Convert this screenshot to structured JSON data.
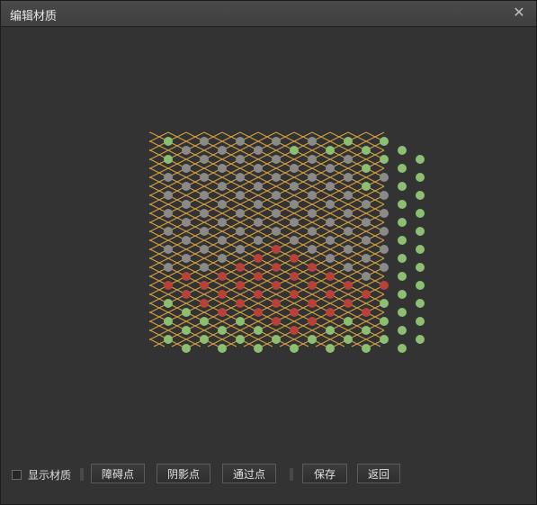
{
  "window": {
    "title": "编辑材质",
    "close_glyph": "✕"
  },
  "toolbar": {
    "show_material_label": "显示材质",
    "obstacle_button": "障碍点",
    "shadow_button": "阴影点",
    "pass_button": "通过点",
    "save_button": "保存",
    "back_button": "返回"
  },
  "colors": {
    "background": "#333333",
    "grid_line": "#d2a043",
    "dot_gray": "#8a8a8a",
    "dot_green": "#8cbf72",
    "dot_red": "#b8423a"
  },
  "grid": {
    "legend": "G = green (pass point), R = red (obstacle point), A = gray",
    "rows": [
      "GAAAAGG",
      "AAAGGGG",
      "GAAAAAGG",
      "AAAAAGG",
      "AAAAAAAG",
      "AAAAAGG",
      "AAAAAAAG",
      "AAAAAAG",
      "AAAAAAAG",
      "AAAAAAG",
      "AAAAAAAG",
      "AAAAAAG",
      "AAARAAAG",
      "AARRAAG",
      "AARRRAAG",
      "RRRRRAG",
      "RRRRRRRG",
      "RRRRRRG",
      "GRRRRRGG",
      "GRRRRRG",
      "GGGRRGGG",
      "GGGRGGG",
      "GGGGGGGG",
      "GGGGGGG"
    ]
  }
}
